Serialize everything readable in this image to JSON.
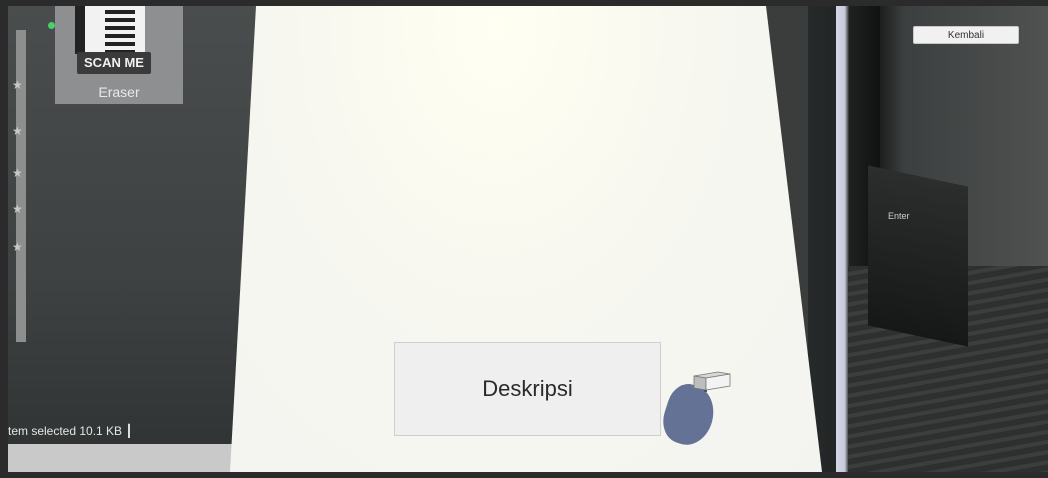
{
  "ar_view": {
    "background_scene": {
      "qr_card_caption": "SCAN ME",
      "qr_card_label": "Eraser",
      "explorer_status": "tem selected  10.1 KB  ┃",
      "key_label": "Enter"
    }
  },
  "buttons": {
    "back_label": "Kembali",
    "description_label": "Deskripsi"
  },
  "colors": {
    "paper": "#f4f4ef",
    "button_bg": "#efefef",
    "shadow": "#4a5a86"
  }
}
